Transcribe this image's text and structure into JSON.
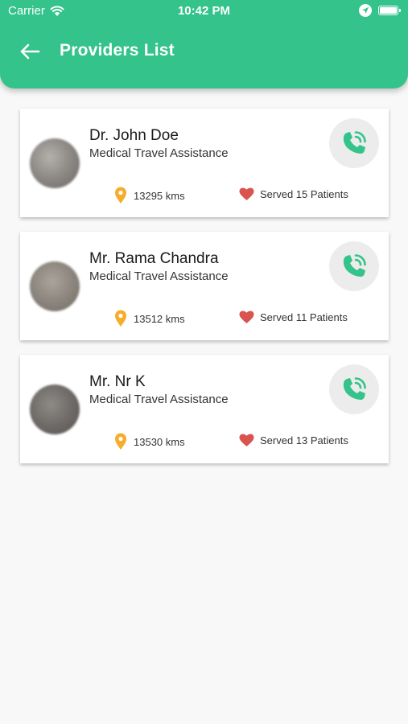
{
  "status_bar": {
    "carrier": "Carrier",
    "time": "10:42 PM"
  },
  "header": {
    "title": "Providers List",
    "back_icon": "arrow-left-icon"
  },
  "colors": {
    "primary": "#33c38b",
    "pin": "#f5ad2b",
    "heart": "#d9534f",
    "call": "#33c38b"
  },
  "providers": [
    {
      "name": "Dr. John Doe",
      "service": "Medical Travel Assistance",
      "distance": "13295 kms",
      "served": "Served 15 Patients"
    },
    {
      "name": "Mr. Rama Chandra",
      "service": "Medical Travel Assistance",
      "distance": "13512 kms",
      "served": "Served 11 Patients"
    },
    {
      "name": "Mr. Nr K",
      "service": "Medical Travel Assistance",
      "distance": "13530 kms",
      "served": "Served 13 Patients"
    }
  ]
}
